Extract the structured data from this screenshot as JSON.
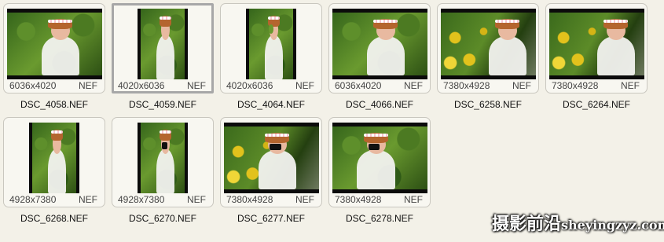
{
  "files": [
    {
      "name": "DSC_4058.NEF",
      "resolution": "6036x4020",
      "ext": "NEF",
      "orientation": "landscape",
      "selected": false,
      "scene": "girl-flowers-sitting"
    },
    {
      "name": "DSC_4059.NEF",
      "resolution": "4020x6036",
      "ext": "NEF",
      "orientation": "portrait",
      "selected": true,
      "scene": "girl-closeup-flowers"
    },
    {
      "name": "DSC_4064.NEF",
      "resolution": "4020x6036",
      "ext": "NEF",
      "orientation": "portrait",
      "selected": false,
      "scene": "girl-leaf-eye"
    },
    {
      "name": "DSC_4066.NEF",
      "resolution": "6036x4020",
      "ext": "NEF",
      "orientation": "landscape",
      "selected": false,
      "scene": "girl-in-bushes"
    },
    {
      "name": "DSC_6258.NEF",
      "resolution": "7380x4928",
      "ext": "NEF",
      "orientation": "landscape",
      "selected": false,
      "scene": "girl-yellow-flowers"
    },
    {
      "name": "DSC_6264.NEF",
      "resolution": "7380x4928",
      "ext": "NEF",
      "orientation": "landscape",
      "selected": false,
      "scene": "girl-yellow-flowers-2"
    },
    {
      "name": "DSC_6268.NEF",
      "resolution": "4928x7380",
      "ext": "NEF",
      "orientation": "portrait",
      "selected": false,
      "scene": "girl-sitting-portrait"
    },
    {
      "name": "DSC_6270.NEF",
      "resolution": "4928x7380",
      "ext": "NEF",
      "orientation": "portrait",
      "selected": false,
      "scene": "girl-camera-portrait"
    },
    {
      "name": "DSC_6277.NEF",
      "resolution": "7380x4928",
      "ext": "NEF",
      "orientation": "landscape",
      "selected": false,
      "scene": "girl-camera-flowers"
    },
    {
      "name": "DSC_6278.NEF",
      "resolution": "7380x4928",
      "ext": "NEF",
      "orientation": "landscape",
      "selected": false,
      "scene": "girl-camera-side"
    }
  ],
  "watermark": {
    "cn": "摄影前沿",
    "en": "sheyingzyz.com"
  },
  "colors": {
    "background": "#f3f1e8",
    "foliage": "#3f6b1f",
    "flowers": "#e2c21c",
    "dress": "#f2f2ef",
    "skin": "#e8b9a0",
    "hair": "#b4652e"
  }
}
